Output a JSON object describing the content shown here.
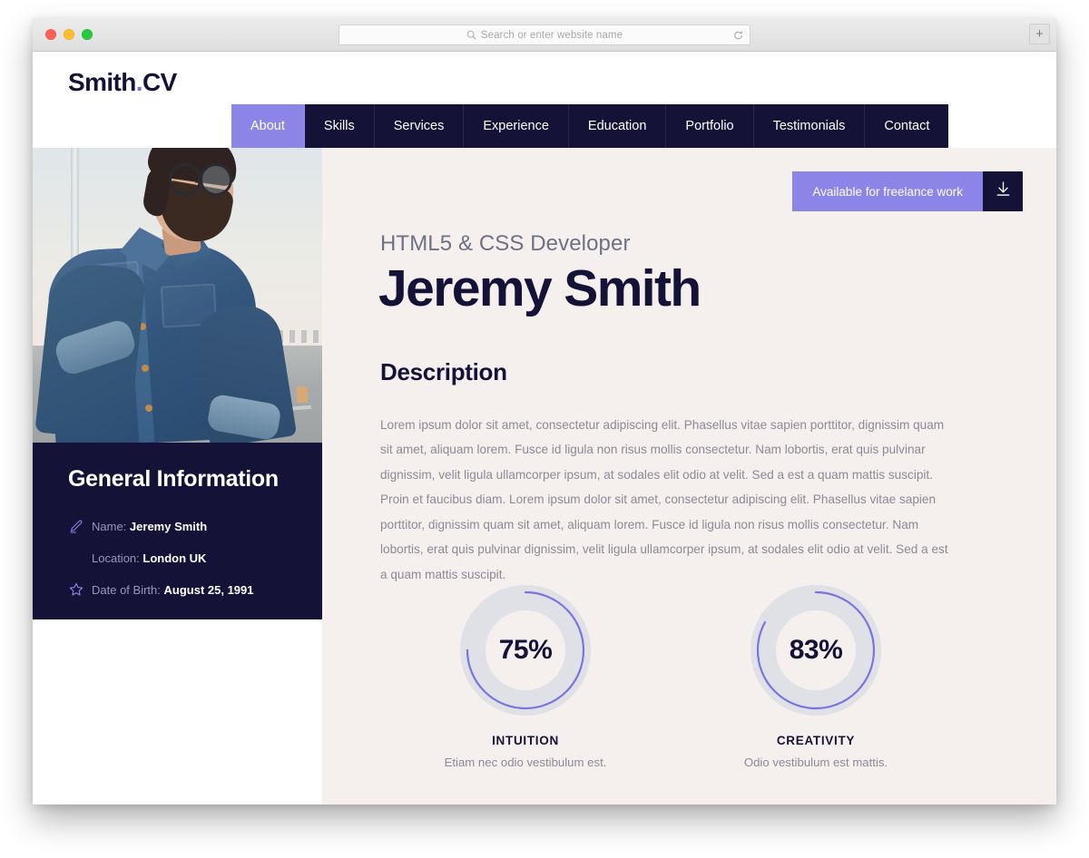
{
  "browser": {
    "address_placeholder": "Search or enter website name",
    "search_icon": "search-icon",
    "reload_icon": "reload-icon",
    "new_tab_label": "+",
    "traffic_lights": [
      "close",
      "minimize",
      "zoom"
    ]
  },
  "site": {
    "logo_main": "Smith",
    "logo_dot": ".",
    "logo_accent": "CV",
    "accent_color": "#8b85e8",
    "dark_color": "#151238",
    "page_bg": "#f5efee"
  },
  "nav": {
    "items": [
      {
        "label": "About",
        "active": true
      },
      {
        "label": "Skills",
        "active": false
      },
      {
        "label": "Services",
        "active": false
      },
      {
        "label": "Experience",
        "active": false
      },
      {
        "label": "Education",
        "active": false
      },
      {
        "label": "Portfolio",
        "active": false
      },
      {
        "label": "Testimonials",
        "active": false
      },
      {
        "label": "Contact",
        "active": false
      }
    ]
  },
  "hero": {
    "freelance_label": "Available for freelance work",
    "download_icon": "download-icon",
    "role": "HTML5 & CSS Developer",
    "name": "Jeremy Smith",
    "photo_alt": "Portrait of a bearded man with glasses wearing a denim shirt on a rooftop"
  },
  "description": {
    "title": "Description",
    "body": "Lorem ipsum dolor sit amet, consectetur adipiscing elit. Phasellus vitae sapien porttitor, dignissim quam sit amet, aliquam lorem. Fusce id ligula non risus mollis consectetur. Nam lobortis, erat quis pulvinar dignissim, velit ligula ullamcorper ipsum, at sodales elit odio at velit. Sed a est a quam mattis suscipit. Proin et faucibus diam. Lorem ipsum dolor sit amet, consectetur adipiscing elit. Phasellus vitae sapien porttitor, dignissim quam sit amet, aliquam lorem. Fusce id ligula non risus mollis consectetur. Nam lobortis, erat quis pulvinar dignissim, velit ligula ullamcorper ipsum, at sodales elit odio at velit. Sed a est a quam mattis suscipit."
  },
  "general_information": {
    "title": "General Information",
    "rows": [
      {
        "icon": "pencil-icon",
        "label": "Name:",
        "value": "Jeremy Smith"
      },
      {
        "icon": "",
        "label": "Location:",
        "value": "London UK"
      },
      {
        "icon": "star-icon",
        "label": "Date of Birth:",
        "value": "August 25, 1991"
      }
    ]
  },
  "chart_data": [
    {
      "type": "pie",
      "title": "INTUITION",
      "caption": "Etiam nec odio vestibulum est.",
      "value": 75,
      "display": "75%",
      "max": 100,
      "arc_color": "#7b74e0",
      "track_color": "#e0e1e6"
    },
    {
      "type": "pie",
      "title": "CREATIVITY",
      "caption": "Odio vestibulum est mattis.",
      "value": 83,
      "display": "83%",
      "max": 100,
      "arc_color": "#7b74e0",
      "track_color": "#e0e1e6"
    }
  ]
}
